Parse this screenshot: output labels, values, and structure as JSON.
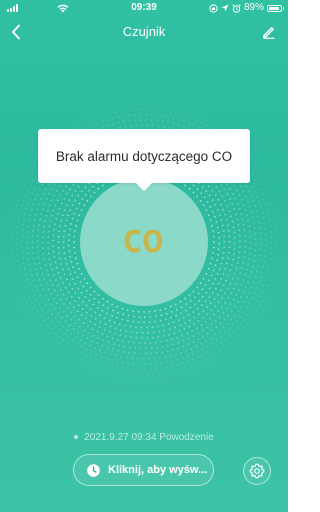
{
  "status_bar": {
    "time": "09:39",
    "battery": "89%",
    "battery_level": 0.89
  },
  "nav": {
    "title": "Czujnik",
    "back_icon": "chevron-left-icon",
    "edit_icon": "pencil-icon"
  },
  "sensor": {
    "alarm_message": "Brak alarmu dotyczącego CO",
    "gas_label": "CO"
  },
  "history": {
    "entry": "2021.9.27 09:34 Powodzenie"
  },
  "actions": {
    "history_button_label": "Kliknij, aby wyśw...",
    "history_button_icon": "clock-icon",
    "settings_icon": "gear-icon"
  },
  "colors": {
    "background": "#2cb99e",
    "circle": "#8ad9c9",
    "co_text": "#c9b54a"
  }
}
